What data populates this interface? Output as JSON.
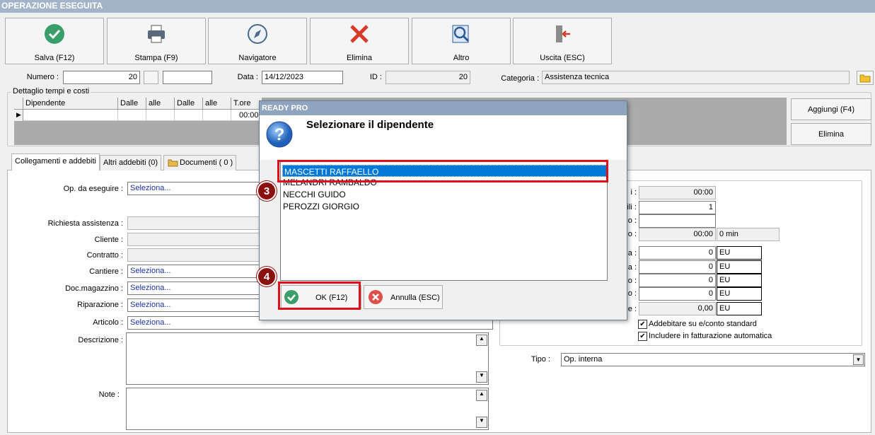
{
  "window": {
    "title": "OPERAZIONE ESEGUITA"
  },
  "toolbar": [
    {
      "label": "Salva (F12)",
      "icon": "check-circle-icon"
    },
    {
      "label": "Stampa (F9)",
      "icon": "printer-icon"
    },
    {
      "label": "Navigatore",
      "icon": "compass-icon"
    },
    {
      "label": "Elimina",
      "icon": "red-x-icon"
    },
    {
      "label": "Altro",
      "icon": "magnifier-icon"
    },
    {
      "label": "Uscita (ESC)",
      "icon": "exit-door-icon"
    }
  ],
  "header": {
    "numero_label": "Numero :",
    "numero_value": "20",
    "data_label": "Data :",
    "data_value": "14/12/2023",
    "id_label": "ID :",
    "id_value": "20",
    "categoria_label": "Categoria :",
    "categoria_value": "Assistenza tecnica"
  },
  "detail": {
    "group_label": "Dettaglio tempi e costi",
    "columns": [
      "Dipendente",
      "Dalle",
      "alle",
      "Dalle",
      "alle",
      "T.ore"
    ],
    "row_tore": "00:00",
    "add_button": "Aggiungi (F4)",
    "delete_button": "Elimina"
  },
  "tabs": [
    "Collegamenti e addebiti",
    "Altri addebiti (0)",
    "Documenti ( 0 )"
  ],
  "form": {
    "op_label": "Op. da eseguire :",
    "op_value": "Seleziona...",
    "richiesta_label": "Richiesta assistenza :",
    "cliente_label": "Cliente :",
    "contratto_label": "Contratto :",
    "cantiere_label": "Cantiere :",
    "cantiere_value": "Seleziona...",
    "docmag_label": "Doc.magazzino :",
    "docmag_value": "Seleziona...",
    "riparazione_label": "Riparazione :",
    "riparazione_value": "Seleziona...",
    "articolo_label": "Articolo :",
    "articolo_value": "Seleziona...",
    "descrizione_label": "Descrizione :",
    "note_label": "Note :"
  },
  "right_panel": {
    "labels": [
      "i :",
      "ili :",
      "o :",
      "o :",
      "a :",
      "a :",
      "o :",
      "o :",
      "e :"
    ],
    "values": [
      "00:00",
      "1",
      "",
      "00:00",
      "0",
      "0",
      "0",
      "0",
      "0,00"
    ],
    "min_value": "0 min",
    "unit": "EU",
    "check1": "Addebitare su e/conto standard",
    "check2": "Includere in fatturazione automatica",
    "tipo_label": "Tipo :",
    "tipo_value": "Op. interna"
  },
  "dialog": {
    "title": "READY PRO",
    "heading": "Selezionare il dipendente",
    "items": [
      "MASCETTI RAFFAELLO",
      "MELANDRI RAMBALDO",
      "NECCHI GUIDO",
      "PEROZZI GIORGIO"
    ],
    "selected": "MASCETTI RAFFAELLO",
    "ok_label": "OK (F12)",
    "cancel_label": "Annulla (ESC)"
  },
  "annotations": {
    "badge_1": "3",
    "badge_2": "4"
  },
  "colors": {
    "title_bar": "#a3b4c8",
    "dialog_title": "#8ea4bf",
    "selection": "#0078d7",
    "highlight_box": "#e0101a",
    "badge": "#8b1010"
  }
}
